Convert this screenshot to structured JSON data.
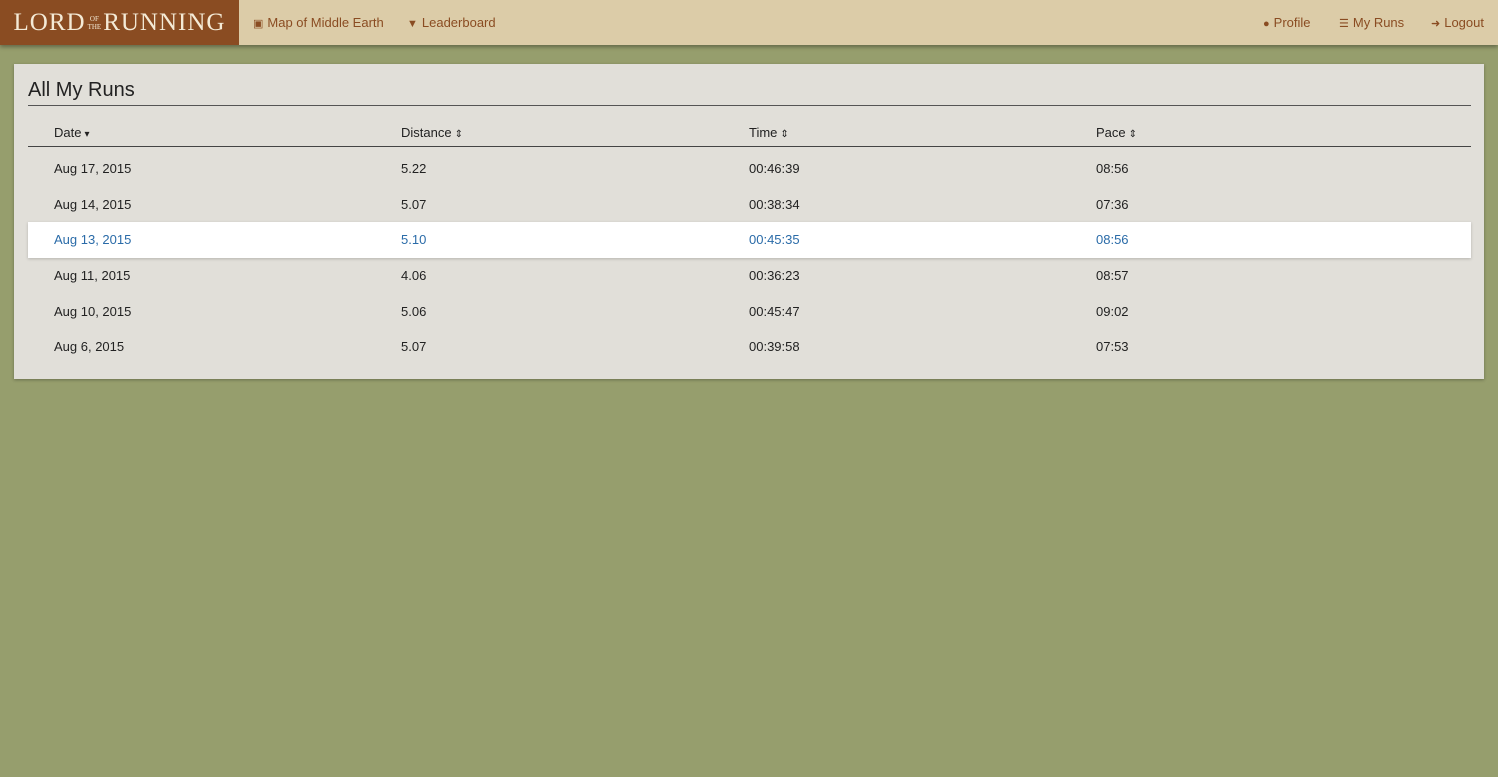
{
  "brand": {
    "lord": "LORD",
    "of": "OF",
    "the": "THE",
    "running": "RUNNING"
  },
  "nav": {
    "map_label": "Map of Middle Earth",
    "leaderboard_label": "Leaderboard",
    "profile_label": "Profile",
    "myruns_label": "My Runs",
    "logout_label": "Logout"
  },
  "page": {
    "title": "All My Runs"
  },
  "table": {
    "columns": [
      "Date",
      "Distance",
      "Time",
      "Pace"
    ],
    "selected_row": 2,
    "rows": [
      [
        "Aug 17, 2015",
        "5.22",
        "00:46:39",
        "08:56"
      ],
      [
        "Aug 14, 2015",
        "5.07",
        "00:38:34",
        "07:36"
      ],
      [
        "Aug 13, 2015",
        "5.10",
        "00:45:35",
        "08:56"
      ],
      [
        "Aug 11, 2015",
        "4.06",
        "00:36:23",
        "08:57"
      ],
      [
        "Aug 10, 2015",
        "5.06",
        "00:45:47",
        "09:02"
      ],
      [
        "Aug 6, 2015",
        "5.07",
        "00:39:58",
        "07:53"
      ]
    ]
  },
  "colors": {
    "background": "#969e6d",
    "navbar": "#dccca8",
    "brand": "#8a4c22",
    "link": "#8a4c22",
    "selected_text": "#2a6ba8"
  }
}
